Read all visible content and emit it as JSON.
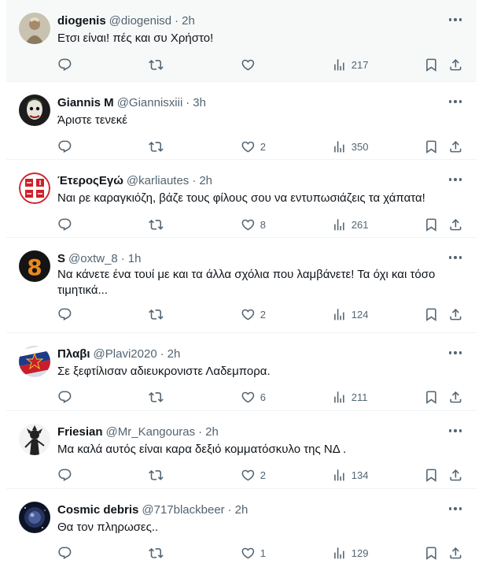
{
  "tweets": [
    {
      "name": "diogenis",
      "handle": "@diogenisd",
      "time": "2h",
      "text": "Ετσι είναι! πές και συ Χρήστο!",
      "replies": "",
      "retweets": "",
      "likes": "",
      "views": "217",
      "avatar_color": "#b8a98c"
    },
    {
      "name": "Giannis M",
      "handle": "@Giannisxiii",
      "time": "3h",
      "text": "Άριστε τενεκέ",
      "replies": "",
      "retweets": "",
      "likes": "2",
      "views": "350",
      "avatar_color": "#2a2a2a"
    },
    {
      "name": "ΈτεροςΕγώ",
      "handle": "@karliautes",
      "time": "2h",
      "text": "Ναι ρε καραγκιόζη, βάζε τους φίλους σου να εντυπωσιάζεις τα χάπατα!",
      "replies": "",
      "retweets": "",
      "likes": "8",
      "views": "261",
      "avatar_color": "#d0202a"
    },
    {
      "name": "S",
      "handle": "@oxtw_8",
      "time": "1h",
      "text": "Να κάνετε ένα τουί με και τα άλλα σχόλια που λαμβάνετε! Τα όχι και τόσο τιμητικά...",
      "replies": "",
      "retweets": "",
      "likes": "2",
      "views": "124",
      "avatar_color": "#e8891c"
    },
    {
      "name": "Πλαβι",
      "handle": "@Plavi2020",
      "time": "2h",
      "text": "Σε ξεφτίλισαν αδιευκρονιστε Λαδεμπορα.",
      "replies": "",
      "retweets": "",
      "likes": "6",
      "views": "211",
      "avatar_color": "#1e3a8a"
    },
    {
      "name": "Friesian",
      "handle": "@Mr_Kangouras",
      "time": "2h",
      "text": "Μα καλά αυτός είναι καρα δεξιό κομματόσκυλο της ΝΔ .",
      "replies": "",
      "retweets": "",
      "likes": "2",
      "views": "134",
      "avatar_color": "#3a3a3a"
    },
    {
      "name": "Cosmic debris",
      "handle": "@717blackbeer",
      "time": "2h",
      "text": "Θα τον πληρωσες..",
      "replies": "",
      "retweets": "",
      "likes": "1",
      "views": "129",
      "avatar_color": "#1a2238"
    }
  ],
  "icons": {
    "reply": "reply-icon",
    "retweet": "retweet-icon",
    "like": "heart-icon",
    "views": "views-icon",
    "bookmark": "bookmark-icon",
    "share": "share-icon",
    "more": "more-icon"
  },
  "colors": {
    "text": "#0f1419",
    "secondary": "#536471",
    "divider": "#eff3f4",
    "highlight_bg": "#f7f9f9"
  }
}
